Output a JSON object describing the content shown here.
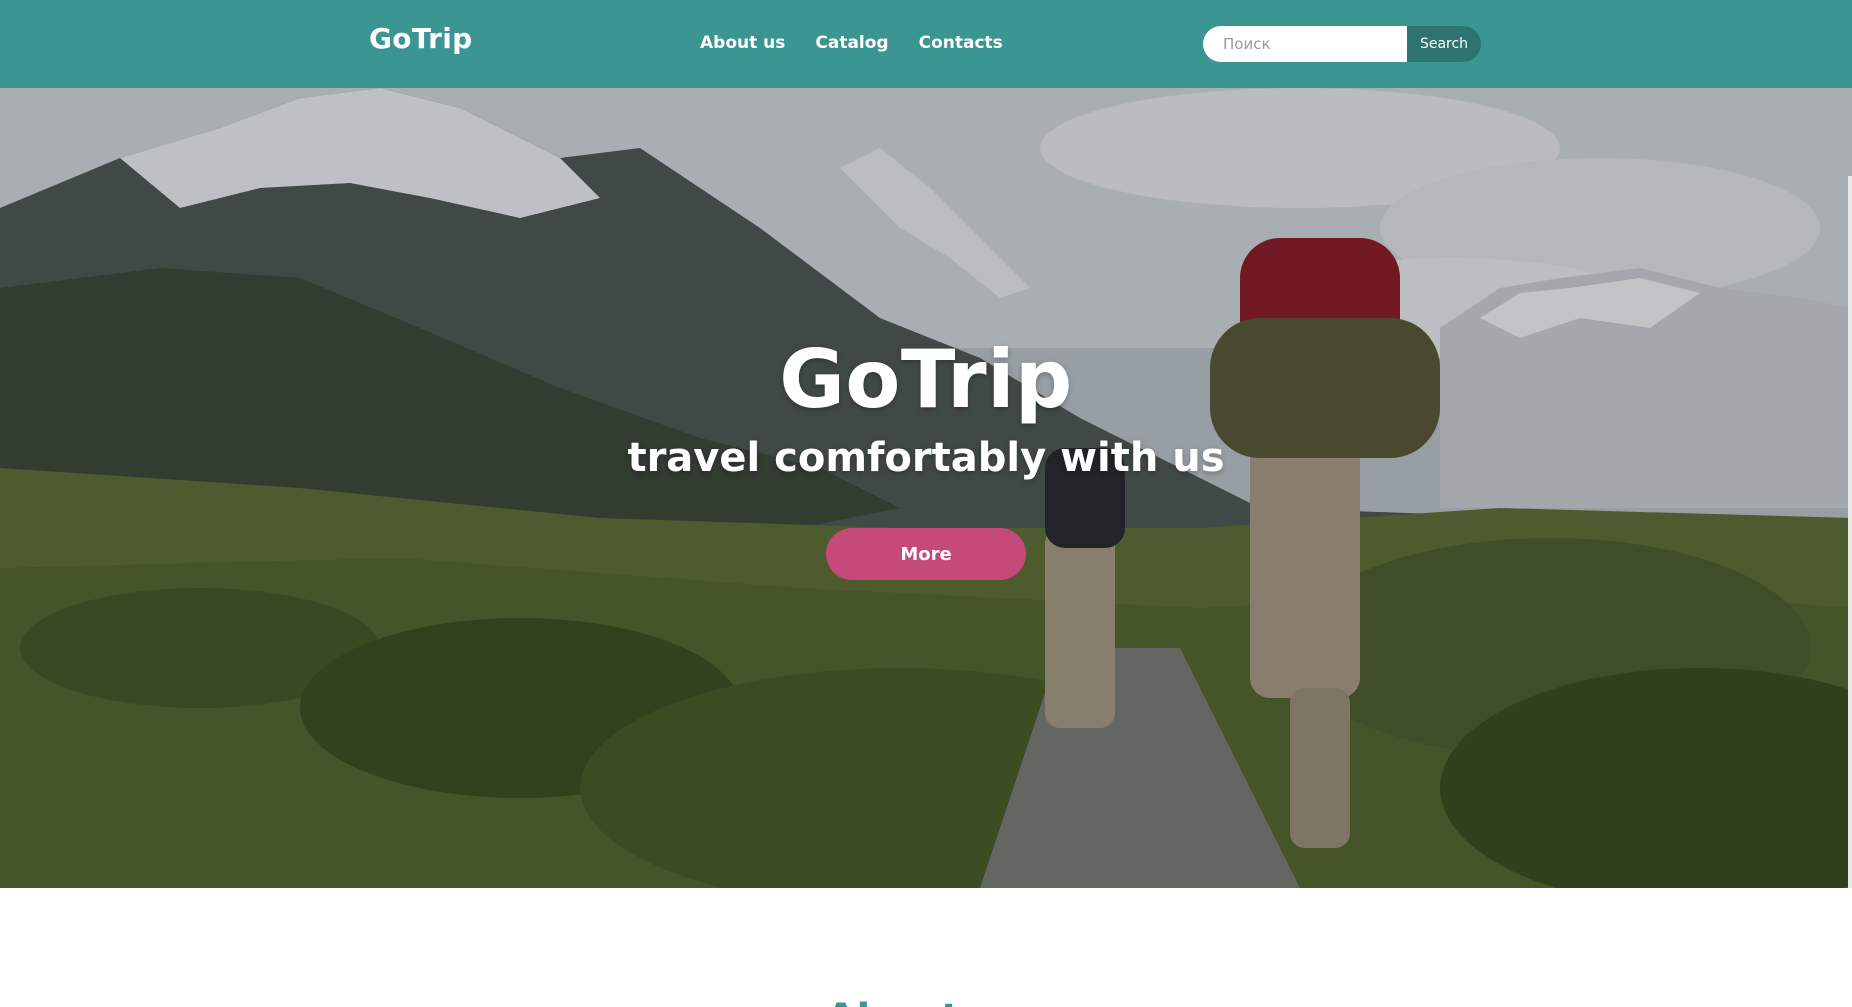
{
  "header": {
    "logo": "GoTrip",
    "nav": [
      "About us",
      "Catalog",
      "Contacts"
    ],
    "search_placeholder": "Поиск",
    "search_button": "Search"
  },
  "hero": {
    "title": "GoTrip",
    "subtitle": "travel comfortably with us",
    "button": "More"
  },
  "about": {
    "title": "About us"
  },
  "colors": {
    "brand": "#3b9590",
    "accent_button": "#c54a7a",
    "search_button": "#2d7470"
  }
}
